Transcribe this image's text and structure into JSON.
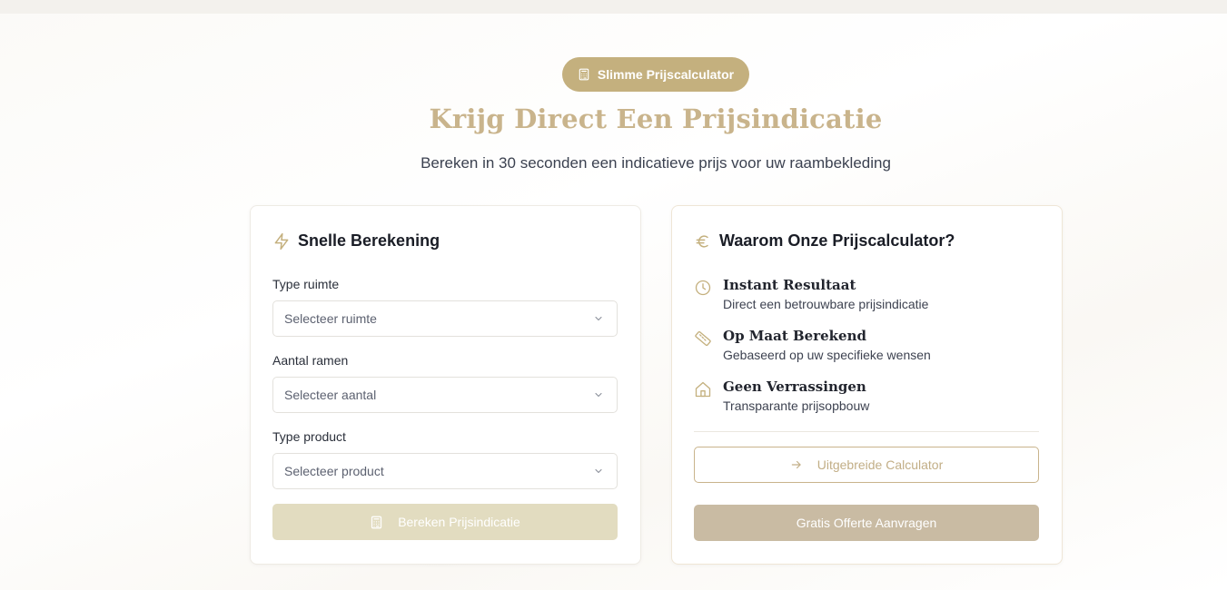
{
  "badge": {
    "label": "Slimme Prijscalculator"
  },
  "hero": {
    "title": "Krijg Direct Een Prijsindicatie",
    "subtitle": "Bereken in 30 seconden een indicatieve prijs voor uw raambekleding"
  },
  "quick_calc": {
    "title": "Snelle Berekening",
    "fields": [
      {
        "label": "Type ruimte",
        "placeholder": "Selecteer ruimte"
      },
      {
        "label": "Aantal ramen",
        "placeholder": "Selecteer aantal"
      },
      {
        "label": "Type product",
        "placeholder": "Selecteer product"
      }
    ],
    "submit_label": "Bereken Prijsindicatie"
  },
  "why": {
    "title": "Waarom Onze Prijscalculator?",
    "features": [
      {
        "icon": "clock-icon",
        "title": "Instant Resultaat",
        "desc": "Direct een betrouwbare prijsindicatie"
      },
      {
        "icon": "ruler-icon",
        "title": "Op Maat Berekend",
        "desc": "Gebaseerd op uw specifieke wensen"
      },
      {
        "icon": "home-icon",
        "title": "Geen Verrassingen",
        "desc": "Transparante prijsopbouw"
      }
    ],
    "extended_label": "Uitgebreide Calculator",
    "quote_label": "Gratis Offerte Aanvragen"
  },
  "colors": {
    "accent": "#c4b07e",
    "title": "#c9b48c",
    "disabled_button": "#e2dcc0",
    "quote_button": "#c9bba3"
  }
}
